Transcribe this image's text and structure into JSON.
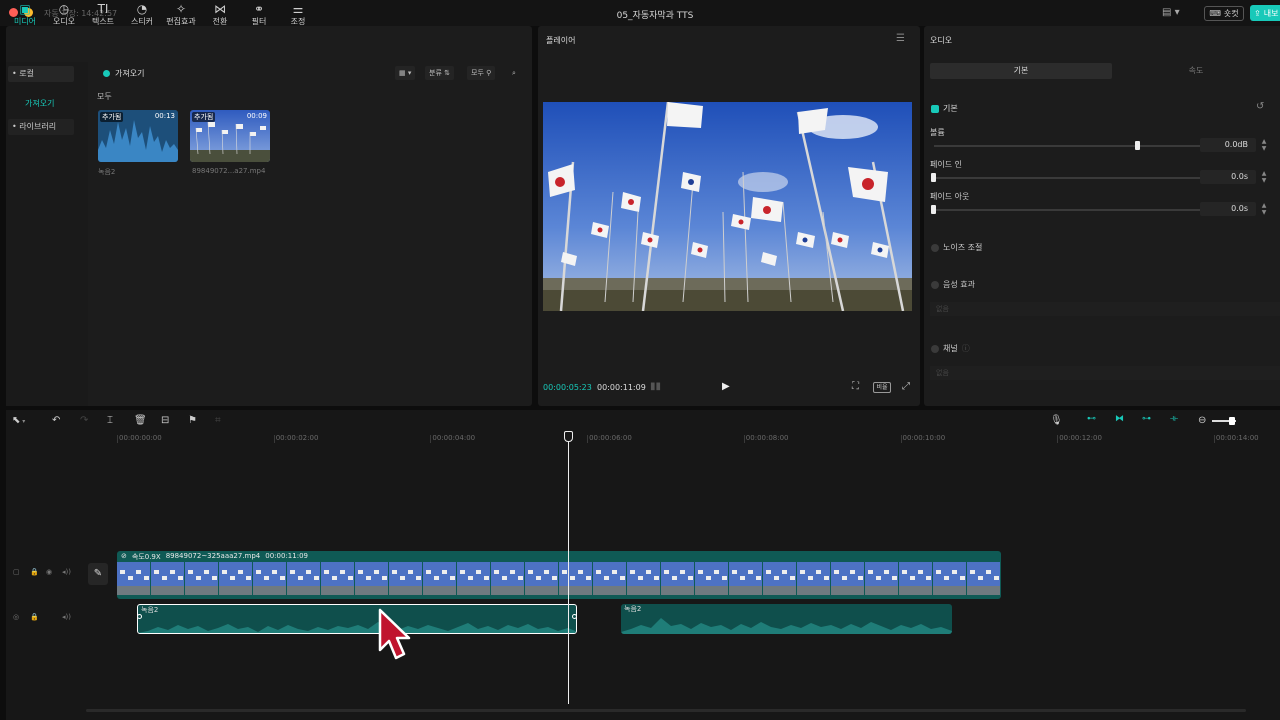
{
  "window": {
    "autosave": "자동 저장: 14:42:57",
    "title": "05_자동자막과 TTS",
    "shortcut_label": "숏컷",
    "export_label": "내보"
  },
  "tools": [
    {
      "label": "미디어",
      "icon": "▣"
    },
    {
      "label": "오디오",
      "icon": "◷"
    },
    {
      "label": "텍스트",
      "icon": "TI"
    },
    {
      "label": "스티커",
      "icon": "◔"
    },
    {
      "label": "편집효과",
      "icon": "✧"
    },
    {
      "label": "전환",
      "icon": "⋈"
    },
    {
      "label": "필터",
      "icon": "⚭"
    },
    {
      "label": "조정",
      "icon": "⚌"
    }
  ],
  "media_sidebar": {
    "local": "• 로컬",
    "import": "가져오기",
    "library": "• 라이브러리"
  },
  "media": {
    "import_title": "가져오기",
    "sort_label": "분류",
    "all_filter": "모두",
    "all_section": "모두",
    "items": [
      {
        "badge": "추가됨",
        "duration": "00:13",
        "name": "녹음2"
      },
      {
        "badge": "추가됨",
        "duration": "00:09",
        "name": "89849072...a27.mp4"
      }
    ]
  },
  "player": {
    "title": "플레이어",
    "current_time": "00:00:05:23",
    "total_time": "00:00:11:09",
    "ratio_label": "비율"
  },
  "props": {
    "title": "오디오",
    "tab_basic": "기본",
    "tab_speed": "속도",
    "basic_section": "기본",
    "volume_label": "볼륨",
    "volume_value": "0.0dB",
    "volume_level": 0.74,
    "fadein_label": "페이드 인",
    "fadein_value": "0.0s",
    "fadeout_label": "페이드 아웃",
    "fadeout_value": "0.0s",
    "noise_label": "노이즈 조절",
    "voice_effect_label": "음성 효과",
    "voice_effect_field": "없음",
    "channel_label": "채널",
    "channel_field": "없음"
  },
  "timeline": {
    "ruler": [
      "00:00:00:00",
      "00:00:02:00",
      "00:00:04:00",
      "00:00:06:00",
      "00:00:08:00",
      "00:00:10:00",
      "00:00:12:00",
      "00:00:14:00"
    ],
    "video_clip": {
      "speed": "속도0.9X",
      "name": "89849072~325aaa27.mp4",
      "duration": "00:00:11:09"
    },
    "audio_clips": [
      {
        "name": "녹음2"
      },
      {
        "name": "녹음2"
      }
    ]
  },
  "colors": {
    "accent": "#18c9b9",
    "clip": "#0f5a55",
    "panel": "#1c1c1c"
  }
}
